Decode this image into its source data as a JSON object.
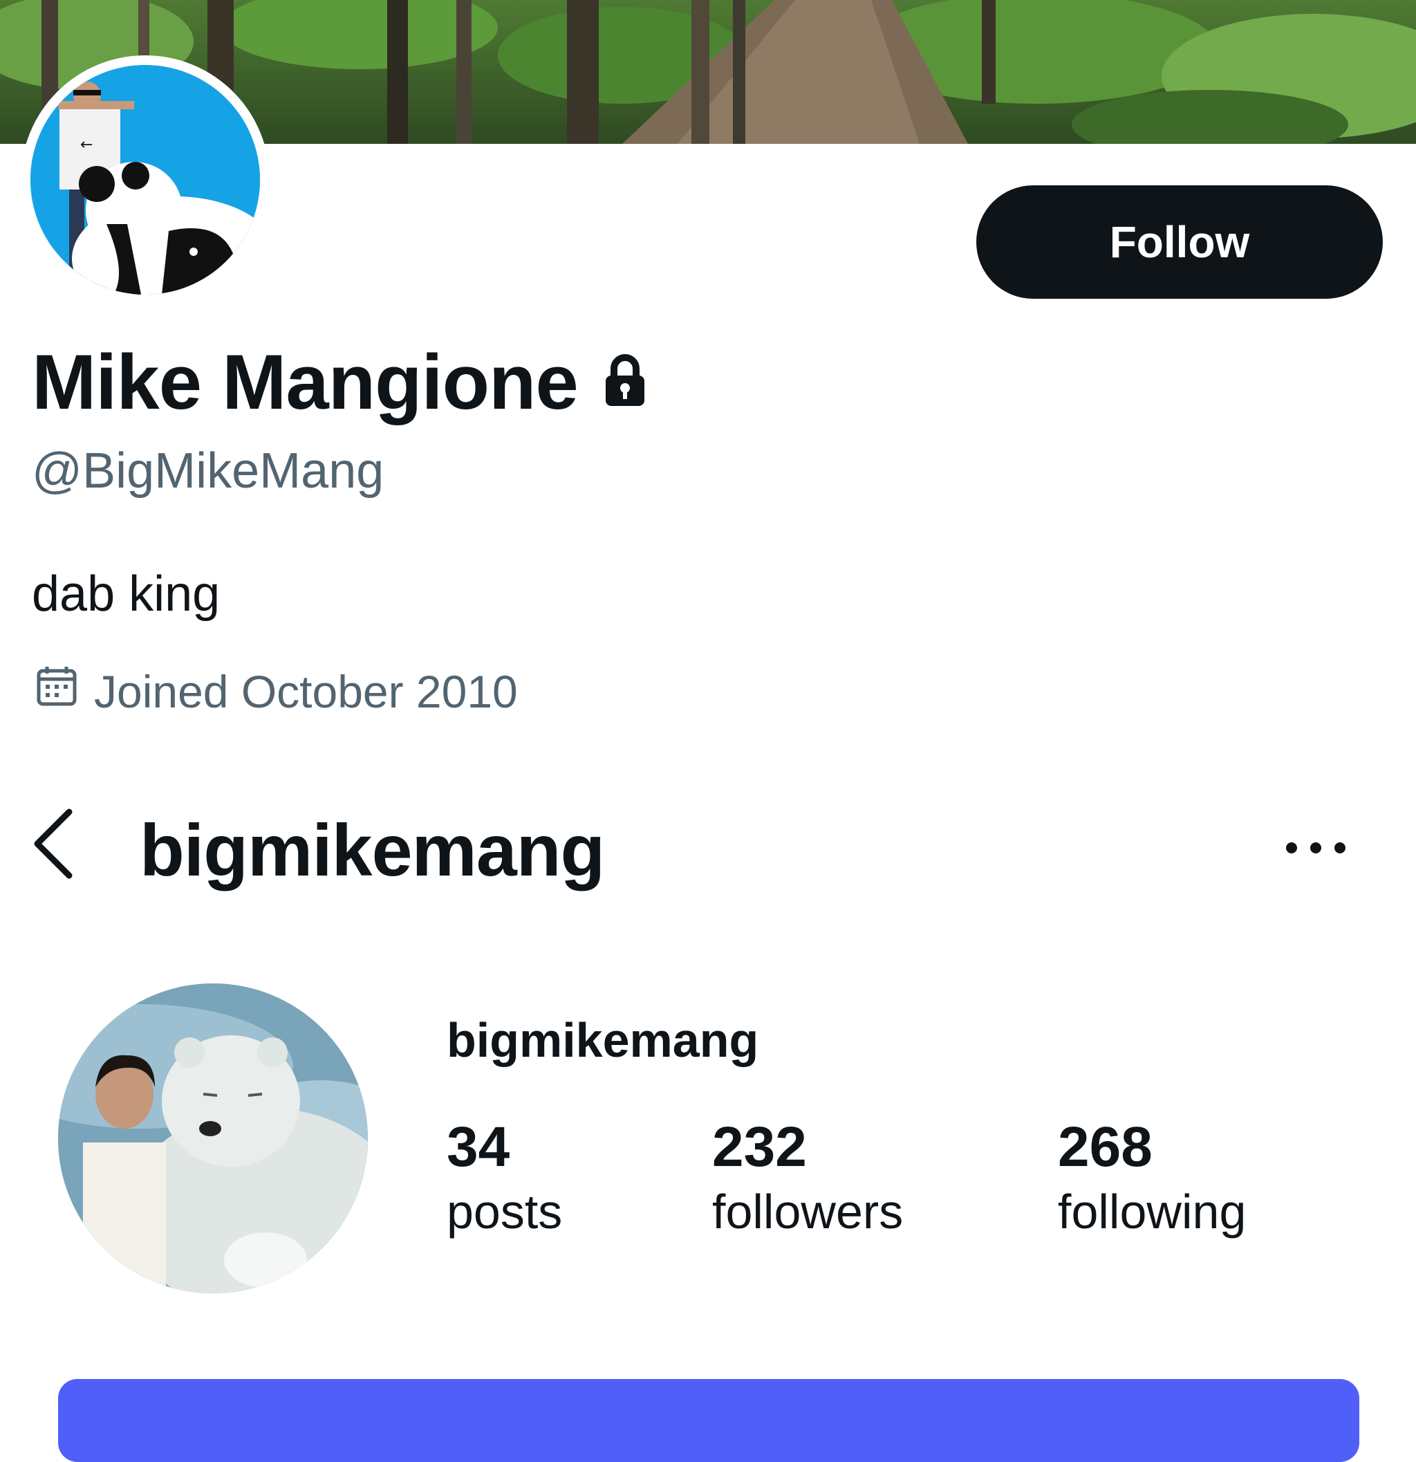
{
  "twitter_profile": {
    "follow_button_label": "Follow",
    "display_name": "Mike Mangione",
    "handle": "@BigMikeMang",
    "bio": "dab king",
    "joined": "Joined October 2010",
    "protected_icon": "lock-icon",
    "joined_icon": "calendar-icon"
  },
  "instagram_header": {
    "title": "bigmikemang",
    "back_icon": "chevron-left-icon",
    "more_icon": "more-horizontal-icon"
  },
  "instagram_profile": {
    "username": "bigmikemang",
    "stats": [
      {
        "value": "34",
        "label": "posts"
      },
      {
        "value": "232",
        "label": "followers"
      },
      {
        "value": "268",
        "label": "following"
      }
    ]
  },
  "colors": {
    "text_primary": "#0f1419",
    "text_secondary": "#536471",
    "follow_button": "#0f1419",
    "instagram_button": "#4f5ff7"
  }
}
